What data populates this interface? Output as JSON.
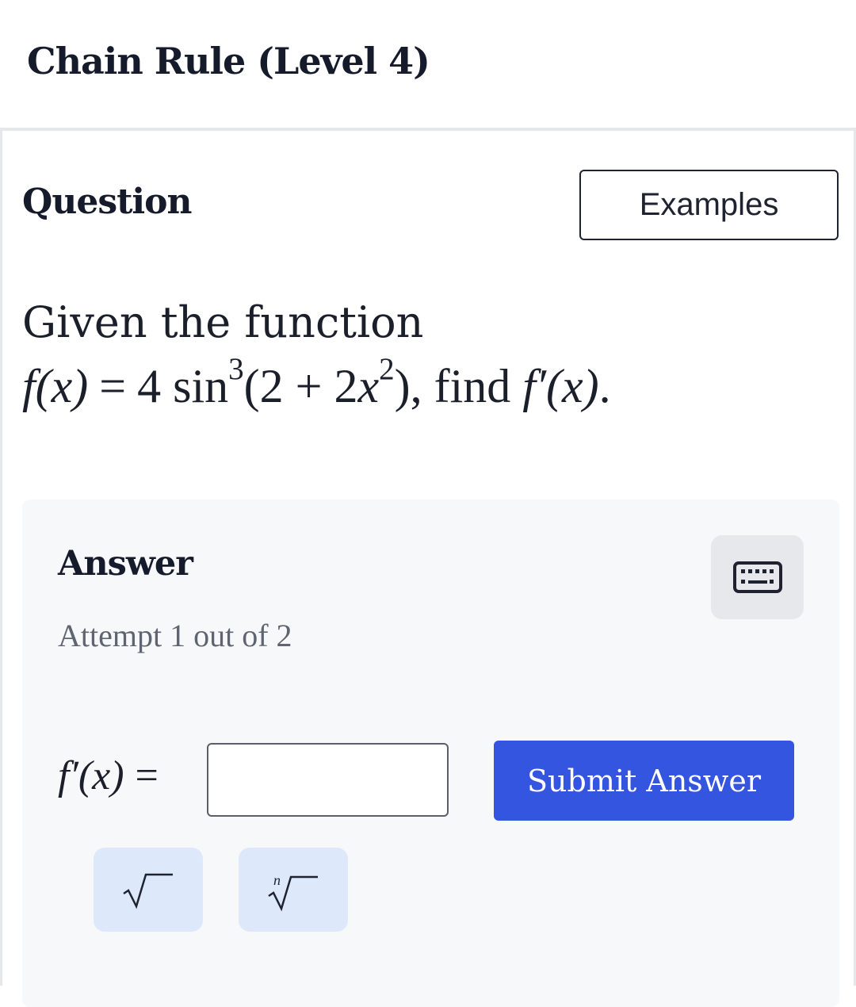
{
  "header": {
    "title": "Chain Rule (Level 4)"
  },
  "question": {
    "heading": "Question",
    "examples_label": "Examples",
    "prompt_intro": "Given the function",
    "function_lhs": "f(x)",
    "function_rhs_coeff": "4 sin",
    "function_exponent": "3",
    "function_inner_open": "(2 + 2",
    "function_inner_var": "x",
    "function_inner_exp": "2",
    "function_inner_close": ")",
    "find_text": ", find ",
    "find_target": "f′(x)",
    "period": "."
  },
  "answer": {
    "heading": "Answer",
    "attempt_text": "Attempt 1 out of 2",
    "label_lhs": "f′(x)",
    "equals": "=",
    "input_value": "",
    "submit_label": "Submit Answer",
    "nthroot_index": "n"
  },
  "colors": {
    "submit_bg": "#3355e0",
    "math_btn_bg": "#dde9fb",
    "keyboard_btn_bg": "#e6e8eb"
  }
}
